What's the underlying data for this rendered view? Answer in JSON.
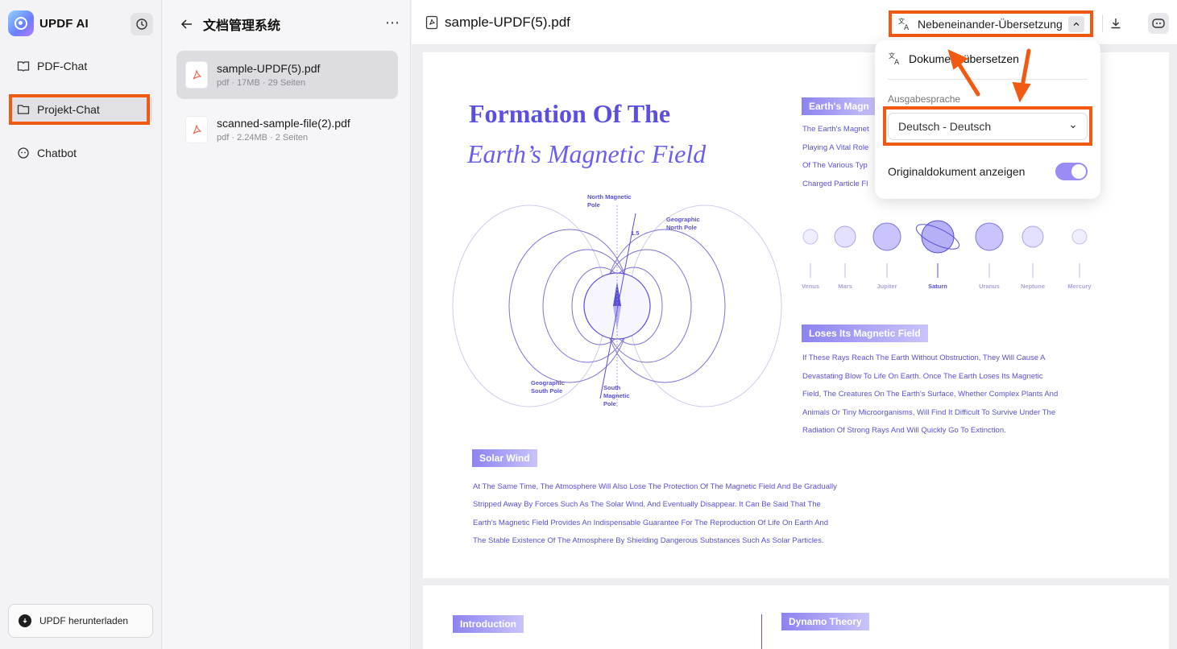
{
  "app": {
    "name": "UPDF AI"
  },
  "sidebar": {
    "items": [
      {
        "label": "PDF-Chat"
      },
      {
        "label": "Projekt-Chat"
      },
      {
        "label": "Chatbot"
      }
    ],
    "download_label": "UPDF herunterladen"
  },
  "file_panel": {
    "title": "文档管理系统",
    "files": [
      {
        "name": "sample-UPDF(5).pdf",
        "meta": "pdf · 17MB · 29 Seiten"
      },
      {
        "name": "scanned-sample-file(2).pdf",
        "meta": "pdf · 2.24MB · 2 Seiten"
      }
    ]
  },
  "viewer": {
    "doc_title": "sample-UPDF(5).pdf",
    "translate_mode": "Nebeneinander-Übersetzung"
  },
  "popup": {
    "translate_doc": "Dokument übersetzen",
    "output_lang_label": "Ausgabesprache",
    "output_lang_value": "Deutsch - Deutsch",
    "show_original_label": "Originaldokument anzeigen",
    "show_original_on": true
  },
  "pdf": {
    "title1": "Formation Of The",
    "title2": "Earth’s Magnetic Field",
    "section1_tag": "Earth's Magn",
    "section1_lines": [
      "The Earth's Magnet",
      "Playing A Vital Role",
      "Of The Various Typ",
      "Charged Particle Fl"
    ],
    "diagram_labels": {
      "north_mag": "North Magnetic Pole",
      "geo_north": "Geographic North Pole",
      "geo_south": "Geographic South Pole",
      "south_mag": "South Magnetic Pole",
      "angle": "1.5"
    },
    "planets": [
      "Venus",
      "Mars",
      "Jupiter",
      "Saturn",
      "Uranus",
      "Neptune",
      "Mercury"
    ],
    "section2_tag": "Loses Its Magnetic Field",
    "section2_lines": [
      "If These Rays Reach The Earth Without Obstruction, They Will Cause A",
      "Devastating Blow To Life On Earth. Once The Earth Loses Its Magnetic",
      "Field, The Creatures On The Earth's Surface, Whether Complex Plants And",
      "Animals Or Tiny Microorganisms, Will Find It Difficult To Survive Under The",
      "Radiation Of Strong Rays And Will Quickly Go To Extinction."
    ],
    "section3_tag": "Solar Wind",
    "section3_lines": [
      "At The Same Time, The Atmosphere Will Also Lose The Protection Of The Magnetic Field And Be Gradually",
      "Stripped Away By Forces Such As The Solar Wind, And Eventually Disappear. It Can Be Said That The",
      "Earth's Magnetic Field Provides An Indispensable Guarantee For The Reproduction Of Life On Earth And",
      "The Stable Existence Of The Atmosphere By Shielding Dangerous Substances Such As Solar Particles."
    ],
    "page2_tag_left": "Introduction",
    "page2_tag_right": "Dynamo Theory"
  },
  "colors": {
    "highlight": "#f05a12",
    "accent": "#5a4fe0",
    "toggle": "#9a8cf5"
  }
}
